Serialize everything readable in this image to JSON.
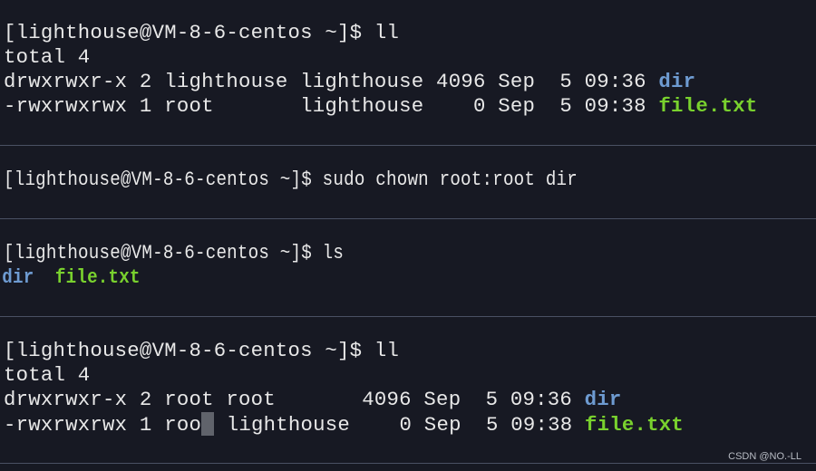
{
  "terminal": {
    "blocks": [
      {
        "prompt": "[lighthouse@VM-8-6-centos ~]$ ",
        "command": "ll",
        "total": "total 4",
        "rows": [
          {
            "meta": "drwxrwxr-x 2 lighthouse lighthouse 4096 Sep  5 09:36 ",
            "name": "dir",
            "type": "dir"
          },
          {
            "meta": "-rwxrwxrwx 1 root       lighthouse    0 Sep  5 09:38 ",
            "name": "file.txt",
            "type": "file"
          }
        ]
      },
      {
        "prompt": "[lighthouse@VM-8-6-centos ~]$ ",
        "command": "sudo chown root:root dir"
      },
      {
        "prompt": "[lighthouse@VM-8-6-centos ~]$ ",
        "command": "ls",
        "listing": {
          "dir": "dir",
          "gap": "  ",
          "file": "file.txt"
        }
      },
      {
        "prompt": "[lighthouse@VM-8-6-centos ~]$ ",
        "command": "ll",
        "total": "total 4",
        "rows": [
          {
            "meta": "drwxrwxr-x 2 root root       4096 Sep  5 09:36 ",
            "name": "dir",
            "type": "dir"
          },
          {
            "meta_before_cursor": "-rwxrwxrwx 1 roo",
            "meta_after_cursor": " lighthouse    0 Sep  5 09:38 ",
            "name": "file.txt",
            "type": "file"
          }
        ]
      }
    ],
    "colors": {
      "background": "#171923",
      "text": "#e8e8e8",
      "directory": "#6e9bd1",
      "file": "#79d12e",
      "separator": "#4a5163",
      "cursor": "#60636b"
    }
  },
  "watermark": "CSDN @NO.-LL"
}
